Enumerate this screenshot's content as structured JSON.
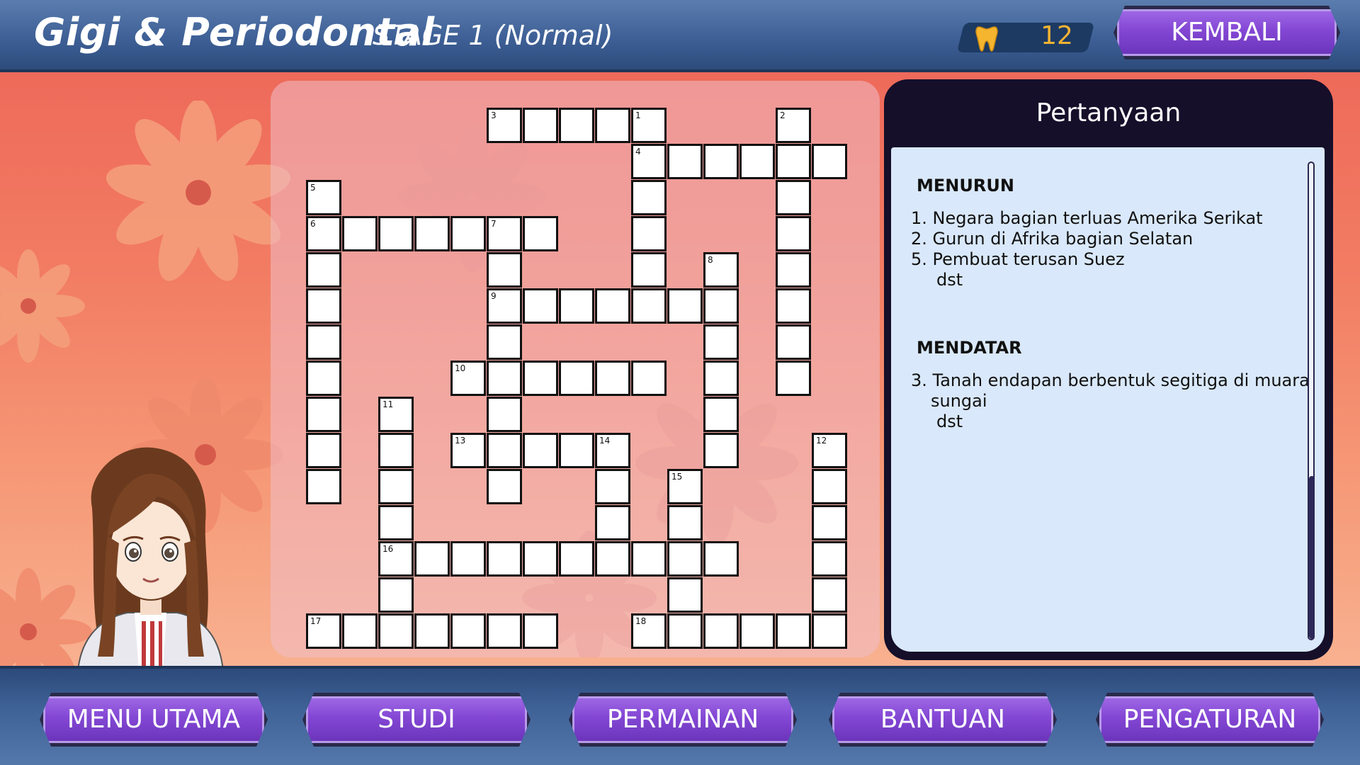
{
  "header": {
    "app_title": "Gigi & Periodontal",
    "stage_label": "STAGE 1 (Normal)",
    "score_icon": "tooth-icon",
    "score_value": "12",
    "back_button": "KEMBALI"
  },
  "crossword": {
    "clue_numbers": [
      "1",
      "2",
      "3",
      "4",
      "5",
      "6",
      "7",
      "8",
      "9",
      "10",
      "11",
      "12",
      "13",
      "14",
      "15",
      "16",
      "17",
      "18"
    ]
  },
  "questions": {
    "title": "Pertanyaan",
    "down_heading": "MENURUN",
    "down_clues": [
      "1.   Negara bagian terluas Amerika Serikat",
      "2. Gurun di Afrika bagian Selatan",
      "5. Pembuat terusan Suez",
      "dst"
    ],
    "across_heading": "MENDATAR",
    "across_clues": [
      "3. Tanah endapan berbentuk segitiga di muara",
      "sungai",
      "dst"
    ]
  },
  "nav": {
    "items": [
      {
        "label": "MENU UTAMA"
      },
      {
        "label": "STUDI"
      },
      {
        "label": "PERMAINAN"
      },
      {
        "label": "BANTUAN"
      },
      {
        "label": "PENGATURAN"
      }
    ]
  },
  "colors": {
    "button_purple": "#8347d4",
    "header_blue": "#3e6096",
    "score_gold": "#f2b233",
    "question_panel_dark": "#150f2a",
    "question_body": "#d9e8fa"
  }
}
